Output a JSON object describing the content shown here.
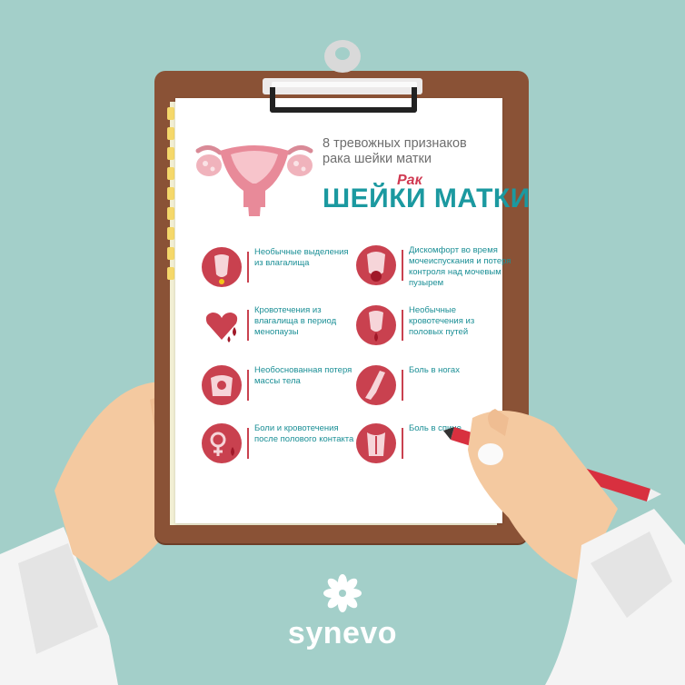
{
  "header": {
    "subtitle": "8 тревожных признаков рака шейки матки",
    "script_word": "Рак",
    "big_title": "ШЕЙКИ МАТКИ"
  },
  "symptoms": [
    {
      "label": "Необычные выделения из влагалища",
      "icon": "discharge-icon"
    },
    {
      "label": "Дискомфорт во время мочеиспускания и потеря контроля над мочевым пузырем",
      "icon": "bladder-icon"
    },
    {
      "label": "Кровотечения из влагалища в период менопаузы",
      "icon": "heart-drop-icon"
    },
    {
      "label": "Необычные кровотечения из половых путей",
      "icon": "bleeding-icon"
    },
    {
      "label": "Необоснованная потеря массы тела",
      "icon": "scale-icon"
    },
    {
      "label": "Боль в ногах",
      "icon": "leg-icon"
    },
    {
      "label": "Боли и кровотечения после полового контакта",
      "icon": "gender-symbol-icon"
    },
    {
      "label": "Боль в спине",
      "icon": "back-icon"
    }
  ],
  "brand": {
    "name": "synevo",
    "logo_icon": "flower-icon"
  },
  "colors": {
    "background": "#a3cfc9",
    "accent_red": "#c9414f",
    "teal_text": "#1b99a0"
  }
}
